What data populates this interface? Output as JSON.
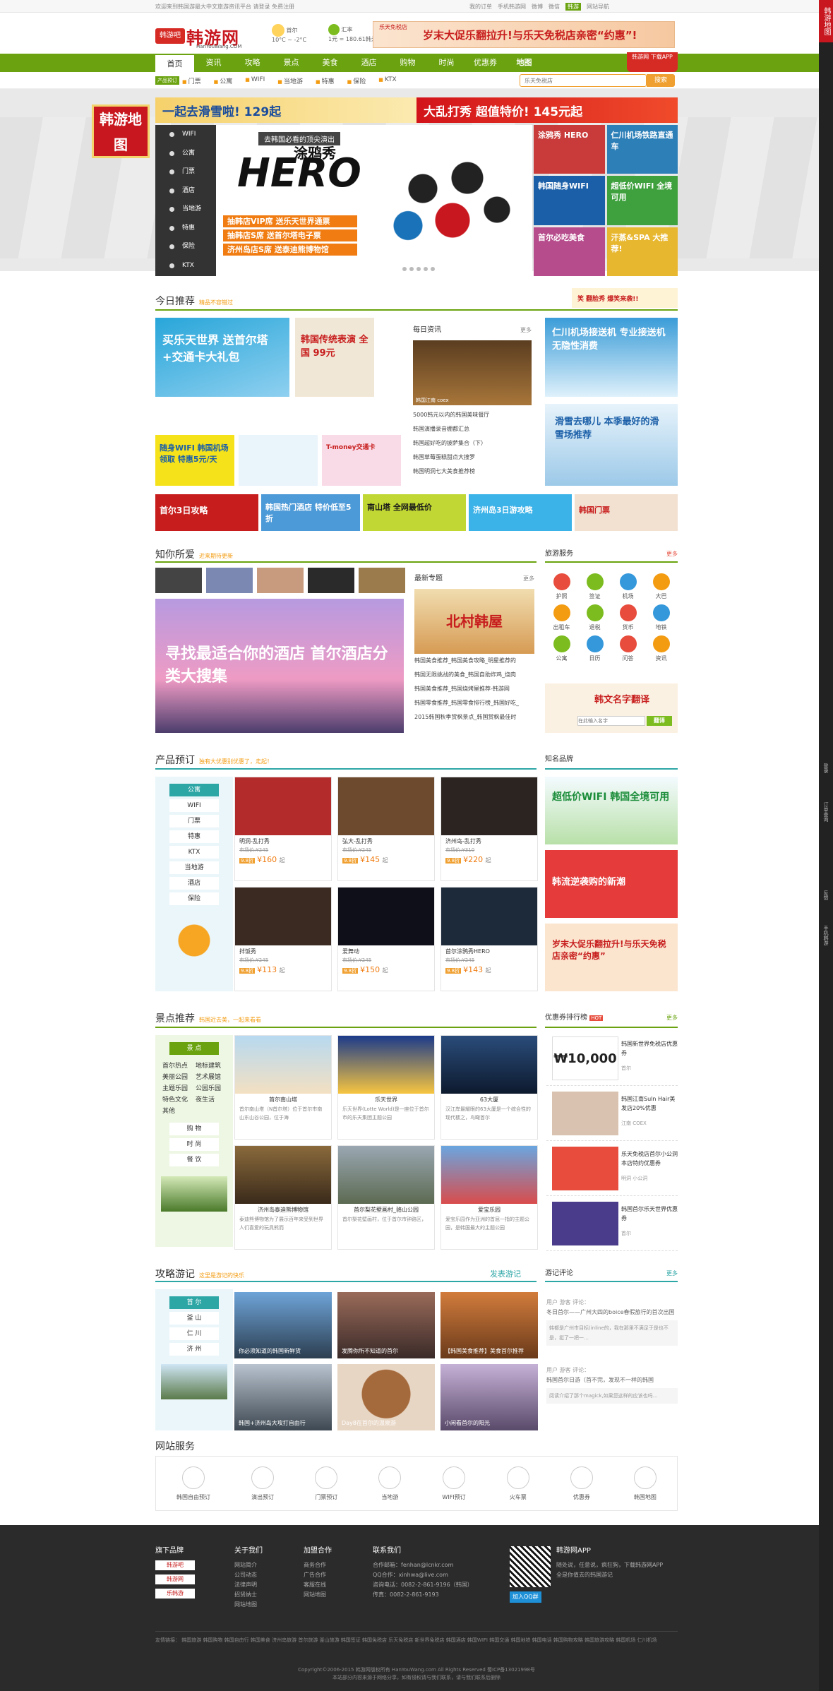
{
  "top_bar": {
    "left": "欢迎来到韩国游最大中文旅游资讯平台 请登录 免费注册",
    "links": [
      "我的订单",
      "手机韩游网",
      "微博",
      "微信",
      "网站导航"
    ],
    "badge": "韩游"
  },
  "logo": {
    "seal": "韩游吧",
    "name": "韩游网",
    "site": "HanYouWang.COM"
  },
  "weather": {
    "city": "首尔",
    "temp": "10°C ~ -2°C"
  },
  "rate": {
    "title": "汇率",
    "value": "1元 = 180.61韩元"
  },
  "top_ad": {
    "brand": "乐天免税店",
    "text": "岁末大促乐翻拉升!与乐天免税店亲密“约惠”!"
  },
  "nav": {
    "items": [
      "首页",
      "资讯",
      "攻略",
      "景点",
      "美食",
      "酒店",
      "购物",
      "时尚",
      "优惠券",
      "地图"
    ],
    "app": "韩游网 下载APP"
  },
  "subnav": {
    "label": "产品预订",
    "items": [
      "门票",
      "公寓",
      "WIFI",
      "当地游",
      "特惠",
      "保险",
      "KTX"
    ],
    "placeholder": "乐天免税店",
    "search": "搜索"
  },
  "float_map": "韩游地图",
  "banner_strip": {
    "a": "一起去滑雪啦!  129起",
    "b": "大乱打秀 超值特价!  145元起"
  },
  "side_menu": [
    "WIFI",
    "公寓",
    "门票",
    "酒店",
    "当地游",
    "特惠",
    "保险",
    "KTX"
  ],
  "hero": {
    "tag": "去韩国必看的顶尖演出",
    "title": "HERO",
    "cn": "涂鸦秀",
    "promos": [
      "抽韩店VIP席 送乐天世界通票",
      "抽韩店S席 送首尔塔电子票",
      "济州岛店S席 送泰迪熊博物馆"
    ]
  },
  "hero_right": [
    "涂鸦秀 HERO",
    "仁川机场铁路直通车",
    "韩国随身WIFI",
    "超低价WIFI 全境可用",
    "首尔必吃美食",
    "汗蒸&SPA 大推荐!"
  ],
  "today": {
    "title": "今日推荐",
    "sub": "精品不容错过",
    "banner": "笑 翻脸秀 爆笑来袭!!"
  },
  "tiles_today": [
    "买乐天世界 送首尔塔+交通卡大礼包",
    "韩国传统表演 全国 99元",
    "随身WIFI 韩国机场领取 特惠5元/天",
    "T-money交通卡",
    "仁川机场接送机 专业接送机 无隐性消费",
    "滑雪去哪儿 本季最好的滑雪场推荐"
  ],
  "daily_news": {
    "title": "每日资讯",
    "more": "更多",
    "caption": "韩国江南 coex",
    "items": [
      "5000韩元以内的韩国美味餐厅",
      "韩国演播录音棚都汇总",
      "韩国超好吃的披萨集合（下）",
      "韩国草莓蛋糕甜点大搜罗",
      "韩国明洞七大美食推荐榜"
    ]
  },
  "strip_ads": [
    "首尔3日攻略",
    "韩国热门酒店 特价低至5折",
    "南山塔 全网最低价",
    "济州岛3日游攻略",
    "韩国门票"
  ],
  "likes": {
    "title": "知你所爱",
    "sub": "近来期待更新",
    "banner": "寻找最适合你的酒店 首尔酒店分类大搜集"
  },
  "topics": {
    "title": "最新专题",
    "more": "更多",
    "img": "北村韩屋",
    "items": [
      "韩国美食推荐_韩国美食攻略_明星推荐的",
      "韩国无限挑战的美食_韩国自助炸鸡_烧肉",
      "韩国美食推荐_韩国烧烤屋推荐-韩游网",
      "韩国零食推荐_韩国零食排行榜_韩国好吃_",
      "2015韩国秋季赏枫景点_韩国赏枫最佳时"
    ]
  },
  "services": {
    "title": "旅游服务",
    "more": "更多",
    "items": [
      "护照",
      "签证",
      "机场",
      "大巴",
      "出租车",
      "退税",
      "货币",
      "地铁",
      "公寓",
      "日历",
      "问答",
      "资讯"
    ],
    "translate": "韩文名字翻译",
    "placeholder": "在此输入名字",
    "btn": "翻译"
  },
  "product": {
    "title": "产品预订",
    "sub": "独有大优惠别优惠了，走起！",
    "side": [
      "公寓",
      "WIFI",
      "门票",
      "特惠",
      "KTX",
      "当地游",
      "酒店",
      "保险"
    ],
    "cards": [
      {
        "name": "明洞-乱打秀",
        "op": "市场价:¥245",
        "pr": "¥160",
        "un": "起"
      },
      {
        "name": "弘大-乱打秀",
        "op": "市场价:¥245",
        "pr": "¥145",
        "un": "起"
      },
      {
        "name": "济州岛-乱打秀",
        "op": "市场价:¥310",
        "pr": "¥220",
        "un": "起"
      },
      {
        "name": "拌饭秀",
        "op": "市场价:¥245",
        "pr": "¥113",
        "un": "起"
      },
      {
        "name": "爱舞动",
        "op": "市场价:¥245",
        "pr": "¥150",
        "un": "起"
      },
      {
        "name": "首尔涂鸦秀HERO",
        "op": "市场价:¥245",
        "pr": "¥143",
        "un": "起"
      }
    ],
    "tag": "9.8折"
  },
  "brands": {
    "title": "知名品牌",
    "items": [
      "超低价WIFI 韩国全境可用",
      "韩流逆袭购的新潮",
      "岁末大促乐翻拉升!与乐天免税店亲密“约惠”"
    ]
  },
  "spots": {
    "title": "景点推荐",
    "sub": "韩国近去美，一起来看看",
    "side_head": "景 点",
    "side_tags": [
      "首尔热点",
      "地标建筑",
      "美丽公园",
      "艺术展馆",
      "主题乐园",
      "公园乐园",
      "特色文化",
      "夜生活",
      "其他"
    ],
    "side_btns": [
      "购 物",
      "时 尚",
      "餐 饮"
    ],
    "cards": [
      {
        "name": "首尔南山塔",
        "desc": "首尔南山塔（N首尔塔）位于首尔市南山东山谷公园，位于海"
      },
      {
        "name": "乐天世界",
        "desc": "乐天世界(Lotte World)是一座位于首尔市的乐天集团主题公园"
      },
      {
        "name": "63大厦",
        "desc": "汉江岸最耀眼的63大厦是一个综合性的现代楼之，鸟瞰首尔"
      },
      {
        "name": "济州岛泰迪熊博物馆",
        "desc": "泰迪熊博物馆为了展示百年来受到世界人们喜爱的玩具熊而"
      },
      {
        "name": "首尔梨花壁画村_骆山公园",
        "desc": "首尔梨花壁画村，位于首尔市钟路区，"
      },
      {
        "name": "爱宝乐园",
        "desc": "爱宝乐园作为亚洲的首屈一指的主题公园，是韩国最大的主题公园"
      }
    ]
  },
  "coupons": {
    "title": "优惠券排行榜",
    "hot": "HOT",
    "more": "更多",
    "items": [
      {
        "t": "韩国新世界免税店优惠券",
        "s": "首尔"
      },
      {
        "t": "韩国江南Suln Hair美发店20%优惠",
        "s": "江南 COEX"
      },
      {
        "t": "乐天免税店首尔小公洞本店特约优惠券",
        "s": "明洞 小公洞"
      },
      {
        "t": "韩国首尔乐天世界优惠券",
        "s": "首尔"
      }
    ],
    "coupon_big": "₩10,000"
  },
  "guides": {
    "title": "攻略游记",
    "sub": "这里是游记的快乐",
    "publish": "发表游记",
    "side_head": "首 尔",
    "side_items": [
      "釜 山",
      "仁 川",
      "济 州"
    ],
    "cards": [
      "你必须知道的韩国新鲜货",
      "发腾你所不知道的首尔",
      "【韩国美食推荐】美食首尔推荐",
      "韩国+济州岛大攻打自由行",
      "Day8在首尔的温泉游",
      "小闲看首尔的阳光"
    ]
  },
  "reviews": {
    "title": "游记评论",
    "more": "更多",
    "items": [
      {
        "u": "用户 游客 评论：",
        "t": "冬日首尔——广州大四的boice春假旅行的首次出国",
        "q": "韩都是广州市目标(inline的，我在那里不满足于是也不是，挺了一把一…"
      },
      {
        "u": "用户 游客 评论：",
        "t": "韩国首尔日游（首不完，发现不一样的韩国",
        "q": "阅读介绍了那个magick,如果您这样的应该也吗…"
      }
    ]
  },
  "site_services": {
    "title": "网站服务",
    "items": [
      "韩国自由预订",
      "演出预订",
      "门票预订",
      "当地游",
      "WIFI预订",
      "火车票",
      "优惠券",
      "韩国地图"
    ]
  },
  "footer": {
    "brands": {
      "h": "旗下品牌",
      "items": [
        "韩游吧",
        "韩游网",
        "乐韩游"
      ]
    },
    "about": {
      "h": "关于我们",
      "items": [
        "网站简介",
        "公司动态",
        "法律声明",
        "招贤纳士",
        "网站地图"
      ]
    },
    "join": {
      "h": "加盟合作",
      "items": [
        "商务合作",
        "广告合作",
        "客服在线",
        "网站地图"
      ]
    },
    "contact": {
      "h": "联系我们",
      "items": [
        "合作邮箱：fenhan@lcnkr.com",
        "QQ合作：xinhwa@live.com",
        "咨询电话：0082-2-861-9196（韩国）",
        "传真：0082-2-861-9193"
      ]
    },
    "app": {
      "h": "韩游网APP",
      "desc": "随处说，任意说，疯狂狗，下载韩游网APP",
      "cta": "全是你值去的韩国游记",
      "qq": "加入QQ群"
    },
    "links": "友情链接：  韩国旅游  韩国购物  韩国自由行  韩国美食  济州岛旅游  首尔旅游  釜山旅游  韩国签证  韩国免税店  乐天免税店  新世界免税店  韩国酒店  韩国WIFI  韩国交通  韩国地铁  韩国电话  韩国购物攻略  韩国旅游攻略  韩国机场  仁川机场",
    "copy": "Copyright©2006-2015 韩游网版权所有 HanYouWang.com All Rights Reserved 蜀ICP备13021998号",
    "copy2": "本站部分内容来源于网络分享，如有侵权请与我们联系，请与我们联系后删除"
  },
  "right_rail": [
    "韩游地图",
    "登录",
    "订单查询",
    "反馈",
    "手机韩游"
  ]
}
